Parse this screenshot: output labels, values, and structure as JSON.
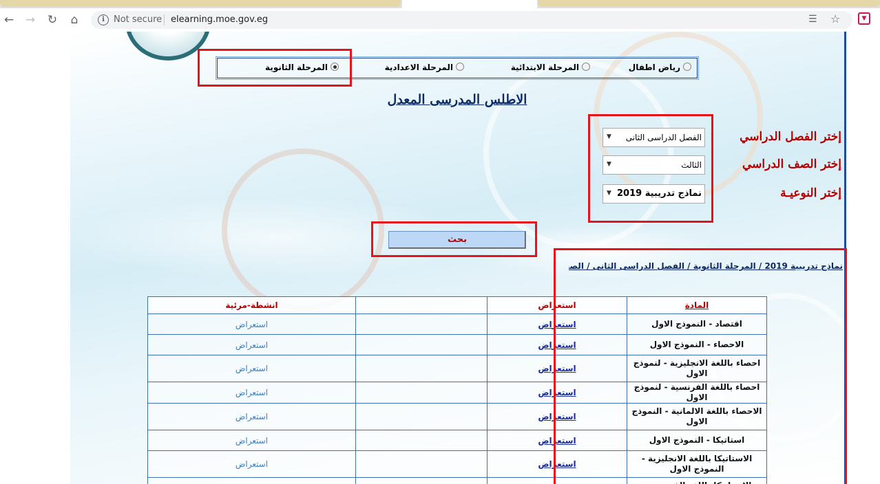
{
  "browser": {
    "url_security": "Not secure",
    "url": "elearning.moe.gov.eg"
  },
  "stages": [
    {
      "label": "رياض اطفال",
      "checked": false
    },
    {
      "label": "المرحلة الابتدائية",
      "checked": false
    },
    {
      "label": "المرحلة الاعدادية",
      "checked": false
    },
    {
      "label": "المرحلة الثانوية",
      "checked": true
    }
  ],
  "page_title": "الاطلس المدرسى المعدل",
  "filters": {
    "term_label": "إختر الفصل الدراسي",
    "term_value": "الفصل الدراسى الثانى",
    "grade_label": "إختر الصف الدراسي",
    "grade_value": "الثالث",
    "type_label": "إختر النوعيـة",
    "type_value": "نماذج تدريبية 2019"
  },
  "search_button": "بحث",
  "breadcrumb": "نماذج تدريبية 2019 / المرحلة الثانوية / الفصل الدراسى الثانى / الصف الثالث",
  "table": {
    "headers": [
      "المادة",
      "استعراض",
      "",
      "انشطة-مرئية"
    ],
    "view_label": "استعراض",
    "rows": [
      {
        "subject": "اقتصاد - النموذج الاول"
      },
      {
        "subject": "الاحصاء - النموذج الاول"
      },
      {
        "subject": "احصاء باللغة الانجليزية - لنموذج الاول"
      },
      {
        "subject": "احصاء باللغة الفرنسية - لنموذج الاول"
      },
      {
        "subject": "الاحصاء باللغة الالمانية - النموذج الاول"
      },
      {
        "subject": "استاتيكا - النموذج الاول"
      },
      {
        "subject": "الاستاتيكا باللغة الانجليزية - النموذج الاول"
      },
      {
        "subject": "الاستاتيكا باللغة الفرنسية - النموذج الاول"
      }
    ]
  },
  "icons": {
    "back": "arrow-left-icon",
    "forward": "arrow-right-icon",
    "reload": "reload-icon",
    "home": "home-icon",
    "info": "info-icon",
    "translate": "translate-icon",
    "bookmark": "star-icon",
    "extension": "extension-icon"
  },
  "colors": {
    "highlight": "#e3141b",
    "label_red": "#b30000",
    "link_blue": "#1a2c9a",
    "border_blue": "#3d6fb5"
  }
}
